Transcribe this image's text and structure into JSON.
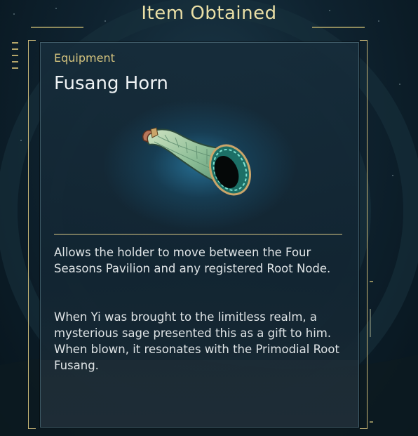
{
  "header": {
    "title": "Item Obtained"
  },
  "item": {
    "category": "Equipment",
    "name": "Fusang Horn",
    "icon": "horn-icon",
    "description_1": "Allows the holder to move between the Four Seasons Pavilion and any registered Root Node.",
    "description_2": "When Yi was brought to the limitless realm, a mysterious sage presented this as a gift to him. When blown, it resonates with the Primodial Root Fusang."
  },
  "colors": {
    "accent_gold": "#d4c37e",
    "title_gold": "#eadfa6",
    "text": "#dfe4e6",
    "horn_green": "#7fb58f"
  }
}
